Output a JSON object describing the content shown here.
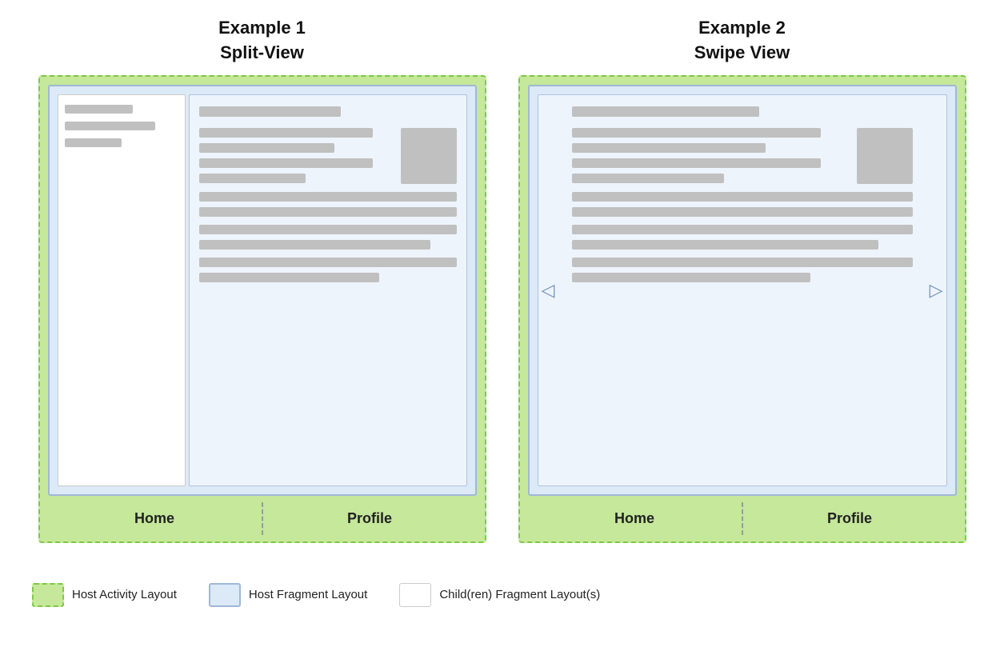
{
  "example1": {
    "title_line1": "Example 1",
    "title_line2": "Split-View",
    "nav_home": "Home",
    "nav_profile": "Profile"
  },
  "example2": {
    "title_line1": "Example 2",
    "title_line2": "Swipe View",
    "nav_home": "Home",
    "nav_profile": "Profile"
  },
  "legend": {
    "host_activity": "Host Activity Layout",
    "host_fragment": "Host Fragment Layout",
    "children_fragment": "Child(ren) Fragment Layout(s)"
  },
  "arrows": {
    "left": "◁",
    "right": "▷"
  }
}
